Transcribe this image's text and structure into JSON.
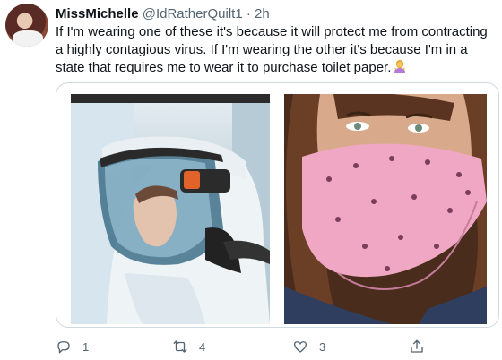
{
  "tweet": {
    "display_name": "MissMichelle",
    "handle": "@IdRatherQuilt1",
    "separator": "·",
    "time": "2h",
    "text": "If I'm wearing one of these it's because it will protect me from contracting a highly contagious virus. If I'm wearing the other it's because I'm in a state that requires me to wear it to purchase toilet paper.",
    "emoji": "woman-shrugging-emoji"
  },
  "media": {
    "left_image": "scientist-in-hazmat-respirator-suit",
    "right_image": "woman-wearing-pink-bandana-face-covering"
  },
  "actions": {
    "reply_count": "1",
    "retweet_count": "4",
    "like_count": "3"
  },
  "icons": {
    "reply": "reply-icon",
    "retweet": "retweet-icon",
    "like": "like-icon",
    "share": "share-icon"
  },
  "colors": {
    "text": "#0f1419",
    "secondary": "#536471",
    "border": "#cfd9de",
    "bandana": "#f0a7c4"
  }
}
